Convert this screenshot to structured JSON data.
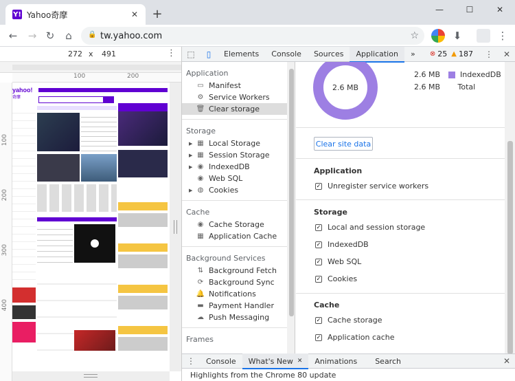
{
  "browser": {
    "tab_title": "Yahoo奇摩",
    "tab_favicon": "Y!",
    "new_tab_symbol": "+",
    "url": "tw.yahoo.com"
  },
  "device_toolbar": {
    "width": "272",
    "times": "x",
    "height": "491"
  },
  "rulers": {
    "top_marks": [
      "100",
      "200"
    ],
    "left_marks": [
      "100",
      "200",
      "300",
      "400"
    ]
  },
  "devtools": {
    "tabs": [
      "Elements",
      "Console",
      "Sources",
      "Application"
    ],
    "active_tab": "Application",
    "more_tabs": "»",
    "errors": "25",
    "warnings": "187"
  },
  "sidebar": {
    "sections": [
      {
        "header": "Application",
        "items": [
          {
            "label": "Manifest",
            "icon": "document-icon"
          },
          {
            "label": "Service Workers",
            "icon": "gear-icon"
          },
          {
            "label": "Clear storage",
            "icon": "trash-icon",
            "selected": true
          }
        ]
      },
      {
        "header": "Storage",
        "items": [
          {
            "label": "Local Storage",
            "icon": "grid-icon",
            "expandable": true
          },
          {
            "label": "Session Storage",
            "icon": "grid-icon",
            "expandable": true
          },
          {
            "label": "IndexedDB",
            "icon": "database-icon",
            "expandable": true
          },
          {
            "label": "Web SQL",
            "icon": "database-icon"
          },
          {
            "label": "Cookies",
            "icon": "cookie-icon",
            "expandable": true
          }
        ]
      },
      {
        "header": "Cache",
        "items": [
          {
            "label": "Cache Storage",
            "icon": "database-icon"
          },
          {
            "label": "Application Cache",
            "icon": "grid-icon"
          }
        ]
      },
      {
        "header": "Background Services",
        "items": [
          {
            "label": "Background Fetch",
            "icon": "updown-icon"
          },
          {
            "label": "Background Sync",
            "icon": "sync-icon"
          },
          {
            "label": "Notifications",
            "icon": "bell-icon"
          },
          {
            "label": "Payment Handler",
            "icon": "card-icon"
          },
          {
            "label": "Push Messaging",
            "icon": "cloud-icon"
          }
        ]
      },
      {
        "header": "Frames",
        "items": []
      }
    ]
  },
  "storage_usage": {
    "donut_label": "2.6 MB",
    "legend": [
      {
        "size": "2.6 MB",
        "label": "IndexedDB",
        "color": "#9d7fe3"
      },
      {
        "size": "2.6 MB",
        "label": "Total"
      }
    ]
  },
  "clear_button": "Clear site data",
  "options": [
    {
      "title": "Application",
      "items": [
        "Unregister service workers"
      ]
    },
    {
      "title": "Storage",
      "items": [
        "Local and session storage",
        "IndexedDB",
        "Web SQL",
        "Cookies"
      ]
    },
    {
      "title": "Cache",
      "items": [
        "Cache storage",
        "Application cache"
      ]
    }
  ],
  "drawer": {
    "tabs": [
      "Console",
      "What's New",
      "Animations",
      "Search"
    ],
    "active_tab": "What's New",
    "content": "Highlights from the Chrome 80 update"
  },
  "yahoo_page": {
    "logo": "yahoo!",
    "logo_sub": "奇摩"
  },
  "colors": {
    "accent": "#1a73e8",
    "donut": "#9d7fe3",
    "yahoo": "#6001d2"
  }
}
